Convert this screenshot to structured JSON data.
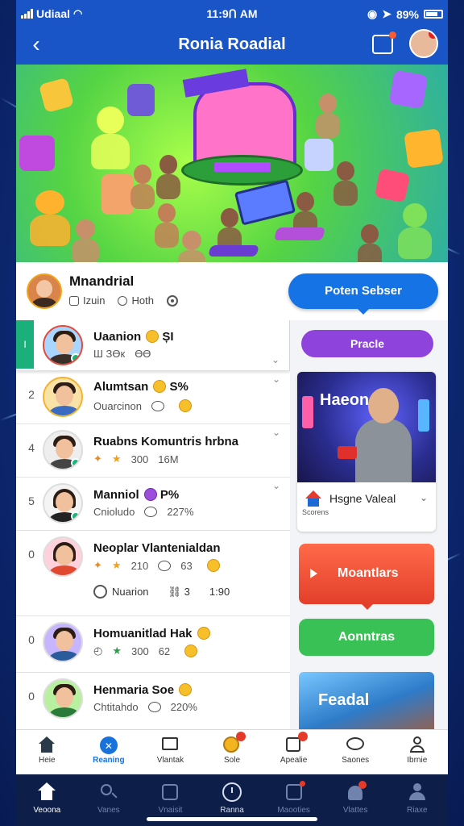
{
  "status_bar": {
    "carrier": "Udiaal",
    "time": "11:9Ո AM",
    "battery": "89%"
  },
  "header": {
    "title": "Ronia Roadial"
  },
  "profile": {
    "name": "Mnandrial",
    "meta1": "Izuin",
    "meta2": "Hoth",
    "follow_label": "Poten Sebser"
  },
  "list": {
    "active_marker": "I",
    "items": [
      {
        "rank": "",
        "title": "Uaanion",
        "title_extra": "ȘI",
        "sub1": "Ш ЗӨк",
        "sub2": "ӨӨ",
        "shirt": "#3a2f28",
        "border": "#e14b3b",
        "badge": true
      },
      {
        "rank": "2",
        "title": "Alumtsan",
        "title_extra": "S%",
        "sub1": "Ouarcinon",
        "sub2": "",
        "shirt": "#3a6bc0",
        "border": "#f2b330",
        "badge": false
      },
      {
        "rank": "4",
        "title": "Ruabns Komuntris hrbna",
        "title_extra": "",
        "sub1": "300",
        "sub2": "16M",
        "shirt": "#444",
        "border": "#dddddd",
        "badge": true
      },
      {
        "rank": "5",
        "title": "Manniol",
        "title_extra": "P%",
        "sub1": "Cnioludo",
        "sub2": "227%",
        "shirt": "#222",
        "border": "#dddddd",
        "badge": true
      },
      {
        "rank": "0",
        "title": "Neoplar Vlantenialdan",
        "title_extra": "",
        "sub1": "210",
        "sub2": "63",
        "shirt": "#e0482f",
        "border": "#dddddd",
        "badge": false
      },
      {
        "rank": "0",
        "title": "Homuanitlad Hak",
        "title_extra": "",
        "sub1": "300",
        "sub2": "62",
        "shirt": "#2a5c9c",
        "border": "#dddddd",
        "badge": false
      },
      {
        "rank": "0",
        "title": "Henmaria Soe",
        "title_extra": "",
        "sub1": "Chtitahdo",
        "sub2": "220%",
        "shirt": "#2a7a3a",
        "border": "#dddddd",
        "badge": false
      }
    ],
    "extra_row": {
      "label": "Nuarion",
      "value_a": "3",
      "value_b": "1:90"
    }
  },
  "right": {
    "pill_label": "Pracle",
    "card_heading": "Haeon",
    "card_title": "Hsgne Valeal",
    "card_small": "Scorens",
    "orange_label": "Moantlars",
    "green_label": "Aonntras",
    "card2_heading": "Feadal"
  },
  "tabs": [
    {
      "label": "Heie",
      "icon": "home-icon",
      "active": false,
      "badge": false
    },
    {
      "label": "Reaning",
      "icon": "compass-icon",
      "active": true,
      "badge": false
    },
    {
      "label": "Vlantak",
      "icon": "chart-icon",
      "active": false,
      "badge": false
    },
    {
      "label": "Sole",
      "icon": "coin-icon",
      "active": false,
      "badge": true
    },
    {
      "label": "Apealie",
      "icon": "tag-icon",
      "active": false,
      "badge": true
    },
    {
      "label": "Saones",
      "icon": "chat-icon",
      "active": false,
      "badge": false
    },
    {
      "label": "Ibrnie",
      "icon": "user-icon",
      "active": false,
      "badge": false
    }
  ],
  "sys_nav": [
    {
      "label": "Veoona",
      "icon": "home-icon",
      "active": true
    },
    {
      "label": "Vanes",
      "icon": "search-icon",
      "active": false
    },
    {
      "label": "Vnaisit",
      "icon": "box-icon",
      "active": false
    },
    {
      "label": "Ranna",
      "icon": "clock-icon",
      "active": false
    },
    {
      "label": "Maooties",
      "icon": "grid-icon",
      "active": false
    },
    {
      "label": "Vlattes",
      "icon": "bell-icon",
      "active": false
    },
    {
      "label": "Riaxe",
      "icon": "person-icon",
      "active": false
    }
  ],
  "colors": {
    "header_blue": "#1a55c7",
    "follow_blue": "#1573e6",
    "purple": "#8e44dc",
    "orange": "#e33f2a",
    "green": "#3ac155",
    "active_green": "#1bb07b"
  }
}
